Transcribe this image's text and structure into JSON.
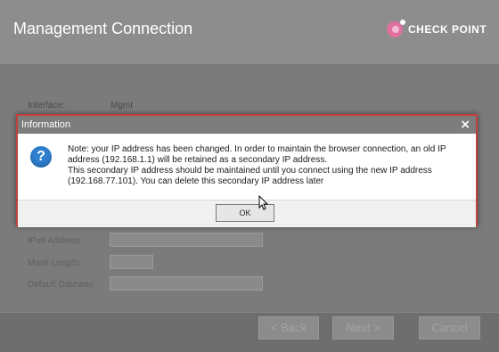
{
  "header": {
    "title": "Management Connection",
    "logo_text": "CHECK POINT"
  },
  "form": {
    "interface_label": "Interface:",
    "interface_value": "Mgmt",
    "ipv6_label": "IPv6 Address:",
    "mask_label": "Mask Length:",
    "gateway_label": "Default Gateway:"
  },
  "footer": {
    "back_label": "< Back",
    "next_label": "Next >",
    "cancel_label": "Cancel"
  },
  "dialog": {
    "title": "Information",
    "close_glyph": "×",
    "icon_glyph": "?",
    "message_line1": "Note: your IP address has been changed. In order to maintain the browser connection, an old IP address (192.168.1.1) will be retained as a secondary IP address.",
    "message_line2": "This secondary IP address should be maintained until you connect using the new IP address (192.168.77.101). You can delete this secondary IP address later",
    "ok_label": "OK"
  },
  "colors": {
    "accent": "#e0709e",
    "info_icon": "#2f7fd0"
  }
}
